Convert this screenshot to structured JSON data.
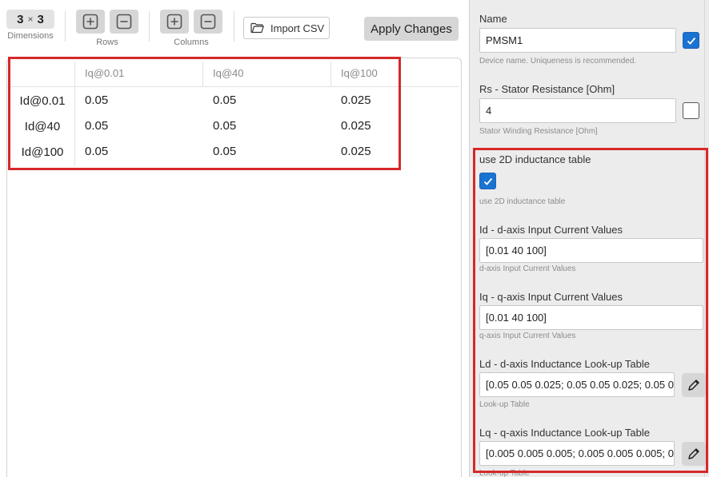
{
  "toolbar": {
    "dims_rows": "3",
    "dims_sep": "×",
    "dims_cols": "3",
    "dims_caption": "Dimensions",
    "rows_caption": "Rows",
    "columns_caption": "Columns",
    "import_label": "Import CSV",
    "apply_label": "Apply Changes"
  },
  "table": {
    "col_headers": [
      "Iq@0.01",
      "Iq@40",
      "Iq@100"
    ],
    "rows": [
      {
        "label": "Id@0.01",
        "values": [
          "0.05",
          "0.05",
          "0.025"
        ]
      },
      {
        "label": "Id@40",
        "values": [
          "0.05",
          "0.05",
          "0.025"
        ]
      },
      {
        "label": "Id@100",
        "values": [
          "0.05",
          "0.05",
          "0.025"
        ]
      }
    ]
  },
  "panel": {
    "name": {
      "label": "Name",
      "value": "PMSM1",
      "hint": "Device name. Uniqueness is recommended.",
      "checked": true
    },
    "rs": {
      "label": "Rs - Stator Resistance [Ohm]",
      "value": "4",
      "hint": "Stator Winding Resistance [Ohm]",
      "checked": false
    },
    "use2d": {
      "label": "use 2D inductance table",
      "hint": "use 2D inductance table",
      "checked": true
    },
    "id_vals": {
      "label": "Id - d-axis Input Current Values",
      "value": "[0.01 40 100]",
      "hint": "d-axis Input Current Values"
    },
    "iq_vals": {
      "label": "Iq - q-axis Input Current Values",
      "value": "[0.01 40 100]",
      "hint": "q-axis Input Current Values"
    },
    "ld": {
      "label": "Ld - d-axis Inductance Look-up Table",
      "value": "[0.05 0.05 0.025; 0.05 0.05 0.025; 0.05 0",
      "hint": "Look-up Table"
    },
    "lq": {
      "label": "Lq - q-axis Inductance Look-up Table",
      "value": "[0.005 0.005 0.005; 0.005 0.005 0.005; 0",
      "hint": "Look-up Table"
    }
  },
  "colors": {
    "accent": "#1a73d0",
    "highlight": "#d62828",
    "panel_bg": "#ececec"
  },
  "icons": [
    "plus-square-icon",
    "minus-square-icon",
    "folder-open-icon",
    "checkmark-icon",
    "pencil-icon"
  ]
}
